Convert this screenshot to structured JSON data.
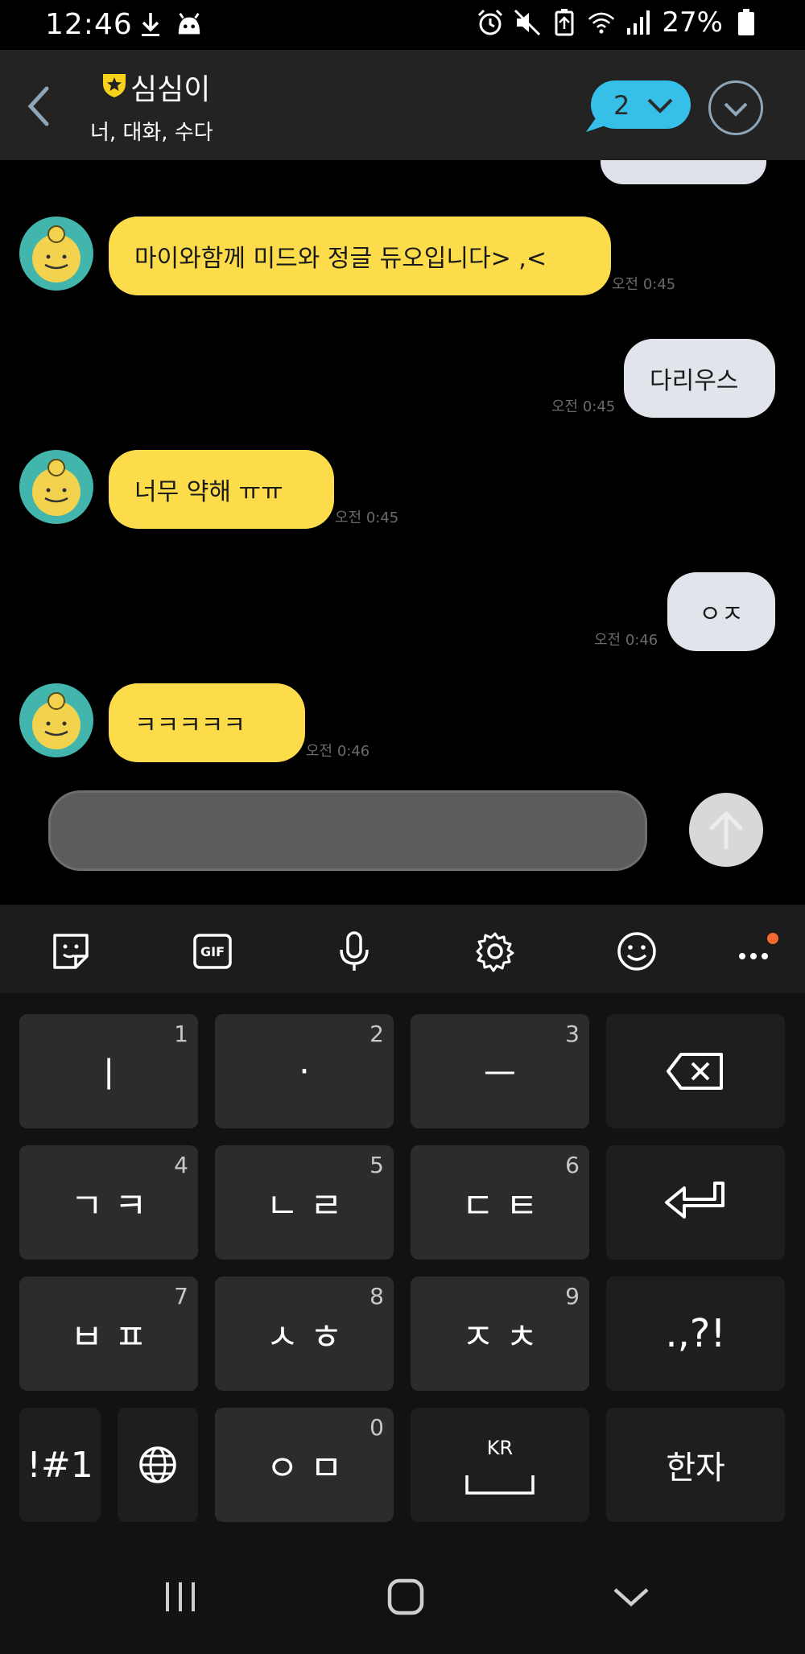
{
  "status_bar": {
    "time": "12:46",
    "battery": "27%",
    "icons": [
      "download-icon",
      "app-notification-icon",
      "alarm-icon",
      "mute-icon",
      "battery-saver-icon",
      "wifi-icon",
      "signal-icon",
      "battery-icon"
    ]
  },
  "header": {
    "title": "심심이",
    "subtitle": "너, 대화, 수다",
    "unread_count": "2",
    "accent": "#36c0e8"
  },
  "messages": [
    {
      "side": "in",
      "text": "마이와함께 미드와 정글 듀오입니다> ,<",
      "time": "오전 0:45"
    },
    {
      "side": "out",
      "text": "다리우스",
      "time": "오전 0:45"
    },
    {
      "side": "in",
      "text": "너무 약해 ㅠㅠ",
      "time": "오전 0:45"
    },
    {
      "side": "out",
      "text": "ㅇㅈ",
      "time": "오전 0:46"
    },
    {
      "side": "in",
      "text": "ㅋㅋㅋㅋㅋ",
      "time": "오전 0:46"
    }
  ],
  "input": {
    "placeholder": ""
  },
  "keyboard": {
    "toolbar": [
      "sticker-icon",
      "gif-icon",
      "microphone-icon",
      "settings-gear-icon",
      "emoji-icon",
      "more-icon"
    ],
    "gif_label": "GIF",
    "rows": [
      [
        {
          "main": "ㅣ",
          "num": "1"
        },
        {
          "main": "·",
          "num": "2"
        },
        {
          "main": "ㅡ",
          "num": "3"
        },
        {
          "main": "",
          "num": "",
          "icon": "backspace-icon"
        }
      ],
      [
        {
          "main": "ㄱ ㅋ",
          "num": "4"
        },
        {
          "main": "ㄴ ㄹ",
          "num": "5"
        },
        {
          "main": "ㄷ ㅌ",
          "num": "6"
        },
        {
          "main": "",
          "num": "",
          "icon": "enter-icon"
        }
      ],
      [
        {
          "main": "ㅂ ㅍ",
          "num": "7"
        },
        {
          "main": "ㅅ ㅎ",
          "num": "8"
        },
        {
          "main": "ㅈ ㅊ",
          "num": "9"
        },
        {
          "main": ".,?!",
          "num": ""
        }
      ],
      [
        {
          "main": "!#1",
          "num": ""
        },
        {
          "main": "",
          "num": "",
          "icon": "globe-icon"
        },
        {
          "main": "ㅇ ㅁ",
          "num": "0"
        },
        {
          "main": "KR",
          "num": ""
        },
        {
          "main": "한자",
          "num": ""
        }
      ]
    ]
  },
  "nav_bar": [
    "recent-apps-icon",
    "home-icon",
    "hide-keyboard-icon"
  ]
}
